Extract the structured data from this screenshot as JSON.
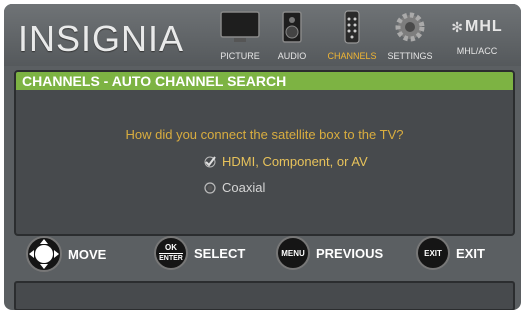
{
  "brand": "INSIGNIA",
  "menu": [
    {
      "label": "PICTURE",
      "icon": "picture-icon",
      "active": false
    },
    {
      "label": "AUDIO",
      "icon": "audio-icon",
      "active": false
    },
    {
      "label": "CHANNELS",
      "icon": "channels-icon",
      "active": true
    },
    {
      "label": "SETTINGS",
      "icon": "settings-icon",
      "active": false
    },
    {
      "label": "MHL/ACC",
      "icon": "mhl-icon",
      "active": false,
      "logo_text": "MHL"
    }
  ],
  "panel": {
    "title": "CHANNELS - AUTO CHANNEL SEARCH",
    "question": "How did you connect the satellite box to the TV?",
    "options": [
      {
        "label": "HDMI, Component, or AV",
        "selected": true
      },
      {
        "label": "Coaxial",
        "selected": false
      }
    ]
  },
  "hints": [
    {
      "button": "",
      "label": "MOVE"
    },
    {
      "button_line1": "OK",
      "button_line2": "ENTER",
      "label": "SELECT"
    },
    {
      "button": "MENU",
      "label": "PREVIOUS"
    },
    {
      "button": "EXIT",
      "label": "EXIT"
    }
  ],
  "colors": {
    "accent": "#7db343",
    "highlight": "#f1b634"
  }
}
